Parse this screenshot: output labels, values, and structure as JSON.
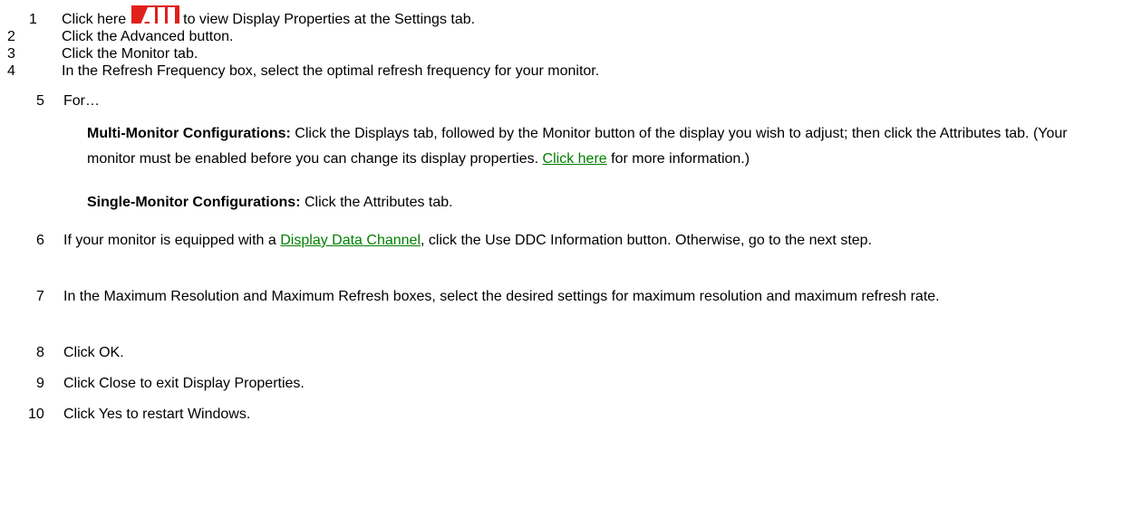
{
  "steps": {
    "s1": {
      "num": "1",
      "pre": "Click here",
      "logo": "ati-logo-icon",
      "post": "to view Display Properties at the Settings tab."
    },
    "s2": {
      "num": "2",
      "text": "Click the Advanced button."
    },
    "s3": {
      "num": "3",
      "text": "Click the Monitor tab."
    },
    "s4": {
      "num": "4",
      "text": "In the Refresh Frequency box, select the optimal refresh frequency for your monitor."
    },
    "s5": {
      "num": "5",
      "text": "For…",
      "multi": {
        "label": "Multi-Monitor Configurations:",
        "text": "Click the Displays tab, followed by the Monitor button of the display you wish to adjust; then click the Attributes tab. (Your monitor must be enabled before you can change its display properties.",
        "link": "Click here",
        "after": "for more information.)"
      },
      "single": {
        "label": "Single-Monitor Configurations:",
        "text": "Click the Attributes tab."
      }
    },
    "s6": {
      "num": "6",
      "pre": "If your monitor is equipped with a",
      "link": "Display Data Channel",
      "post": ", click the Use DDC Information button. Otherwise, go to the next step."
    },
    "s7": {
      "num": "7",
      "text": "In the Maximum Resolution and Maximum Refresh boxes, select the desired settings for maximum resolution and maximum refresh rate."
    },
    "s8": {
      "num": "8",
      "text": "Click OK."
    },
    "s9": {
      "num": "9",
      "text": "Click Close to exit Display Properties."
    },
    "s10": {
      "num": "10",
      "text": "Click Yes to restart Windows."
    }
  },
  "colors": {
    "link": "#008000",
    "logo": "#e0201b"
  }
}
